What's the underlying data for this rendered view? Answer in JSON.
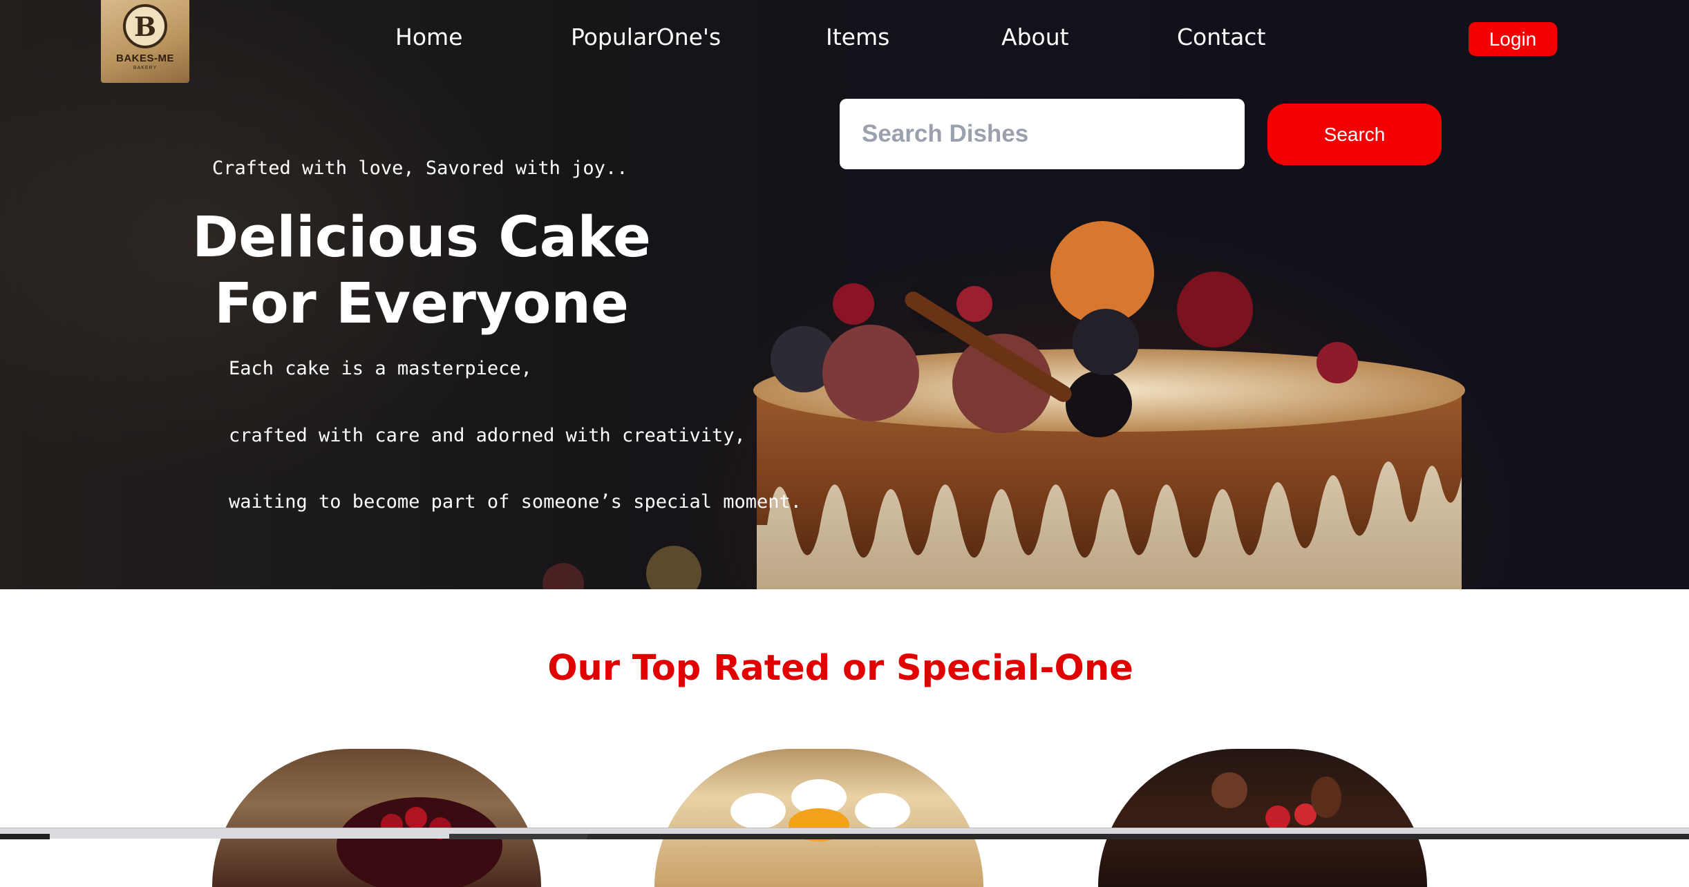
{
  "brand": {
    "logo_letter": "B",
    "logo_name": "BAKES-ME",
    "logo_sub": "BAKERY"
  },
  "nav": {
    "items": [
      {
        "label": "Home"
      },
      {
        "label": "PopularOne's"
      },
      {
        "label": "Items"
      },
      {
        "label": "About"
      },
      {
        "label": "Contact"
      }
    ],
    "login_label": "Login"
  },
  "search": {
    "placeholder": "Search Dishes",
    "value": "",
    "button_label": "Search"
  },
  "hero": {
    "tagline": "Crafted with love, Savored with joy..",
    "headline_line1": "Delicious Cake",
    "headline_line2": "For Everyone",
    "description": [
      "Each cake is a masterpiece,",
      "crafted with care and adorned with creativity,",
      "waiting to become part of someone’s special moment."
    ]
  },
  "section": {
    "title": "Our Top Rated or Special-One"
  },
  "colors": {
    "accent": "#f40000",
    "section_title": "#e00000",
    "text_light": "#ffffff",
    "placeholder": "#9aa1ad"
  }
}
